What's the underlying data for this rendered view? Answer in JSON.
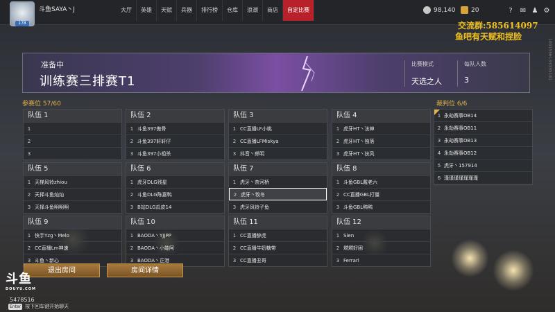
{
  "topbar": {
    "username": "斗鱼SAYA丶J",
    "level": "178",
    "nav": [
      "大厅",
      "英雄",
      "天赋",
      "兵器",
      "排行榜",
      "仓库",
      "浪潮",
      "商店",
      "自定比赛"
    ],
    "active_nav": "自定比赛",
    "gold": "98,140",
    "gems": "20",
    "icons": [
      "help-icon",
      "mail-icon",
      "friends-icon",
      "settings-icon"
    ]
  },
  "promo": {
    "line1": "交流群:585614097",
    "line2": "鱼吧有天赋和捏脸"
  },
  "video_id": "1001556133335181",
  "banner": {
    "status": "准备中",
    "title": "训练赛三排赛T1",
    "mode_label": "比赛模式",
    "mode_value": "天选之人",
    "per_team_label": "每队人数",
    "per_team_value": "3"
  },
  "participants_label": "参赛位 57/60",
  "referees_label": "裁判位 6/6",
  "teams": [
    {
      "name": "队伍 1",
      "players": [
        "",
        "",
        ""
      ]
    },
    {
      "name": "队伍 2",
      "players": [
        "斗鱼397傲骨",
        "斗鱼397轩轩仔",
        "斗鱼397小祖杀"
      ]
    },
    {
      "name": "队伍 3",
      "players": [
        "CC直播LF小桃",
        "CC直播LFMiskya",
        "抖音丶郎明"
      ]
    },
    {
      "name": "队伍 4",
      "players": [
        "虎牙HT丶法神",
        "虎牙HT丶独落",
        "虎牙HT丶扶风"
      ]
    },
    {
      "name": "队伍 5",
      "players": [
        "天梯风铃zhiou",
        "天择斗鱼灿灿",
        "天择斗鱼明明明"
      ]
    },
    {
      "name": "队伍 6",
      "players": [
        "虎牙DLG残星",
        "斗鱼DLG陈嘉鸭",
        "B站DLG瓜皮14"
      ]
    },
    {
      "name": "队伍 7",
      "players": [
        "虎牙丶奈河桥",
        "虎牙丶牧冬",
        "虎牙风铃子鱼"
      ]
    },
    {
      "name": "队伍 8",
      "players": [
        "斗鱼GBL戴老六",
        "CC直播GBL打僵",
        "斗鱼GBL鸭鸭"
      ]
    },
    {
      "name": "队伍 9",
      "players": [
        "快手Yzg丶Melo",
        "CC直播Lm神速",
        "斗鱼丶新心"
      ]
    },
    {
      "name": "队伍 10",
      "players": [
        "BAODA丶YJJPP",
        "BAODA丶小能阿",
        "BAODA丶正港"
      ]
    },
    {
      "name": "队伍 11",
      "players": [
        "CC直播醉虎",
        "CC直播牛奶糖带",
        "CC直播丑哥"
      ]
    },
    {
      "name": "队伍 12",
      "players": [
        "Sien",
        "燃燃好困",
        "Ferrari"
      ]
    }
  ],
  "selected_slot": {
    "team": 6,
    "slot": 1
  },
  "referees": [
    "永劫赛事OB14",
    "永劫赛事OB11",
    "永劫赛事OB13",
    "永劫赛事OB12",
    "虎牙丶157914",
    "瑾瑾瑾瑾瑾瑾瑾"
  ],
  "buttons": {
    "leave": "退出房间",
    "details": "房间详情"
  },
  "logo": {
    "main": "斗鱼",
    "sub": "DOUYU.COM"
  },
  "room_id": "5478516",
  "chat": {
    "key": "Enter",
    "hint": "按下回车键开始聊天"
  },
  "colors": {
    "accent_red": "#b8212a",
    "gold_text": "#e3b44a",
    "promo_yellow": "#f0c020"
  }
}
